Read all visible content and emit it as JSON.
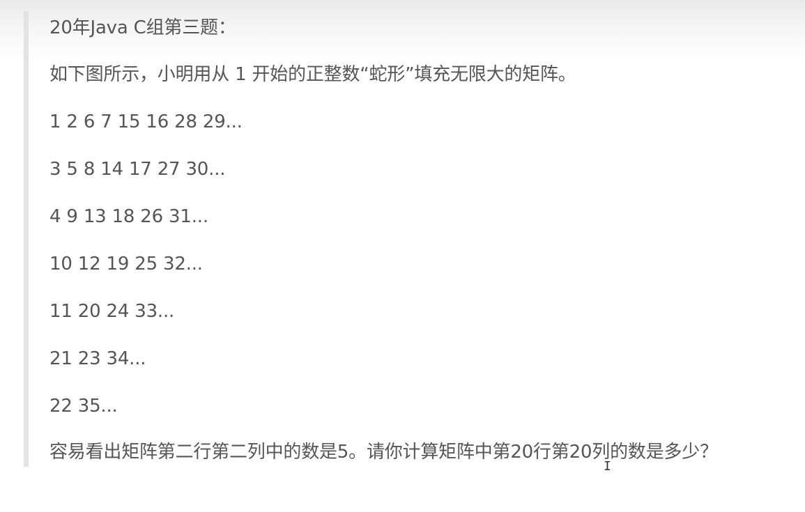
{
  "blockquote": {
    "title": "20年Java C组第三题：",
    "intro": "如下图所示，小明用从 1 开始的正整数“蛇形”填充无限大的矩阵。",
    "rows": [
      "1 2 6 7 15 16 28 29...",
      "3 5 8 14 17 27 30...",
      "4 9 13 18 26 31...",
      "10 12 19 25 32...",
      "11 20 24 33...",
      "21 23 34...",
      "22 35..."
    ],
    "question": "容易看出矩阵第二行第二列中的数是5。请你计算矩阵中第20行第20列的数是多少？"
  },
  "cursor": {
    "glyph": "I"
  }
}
